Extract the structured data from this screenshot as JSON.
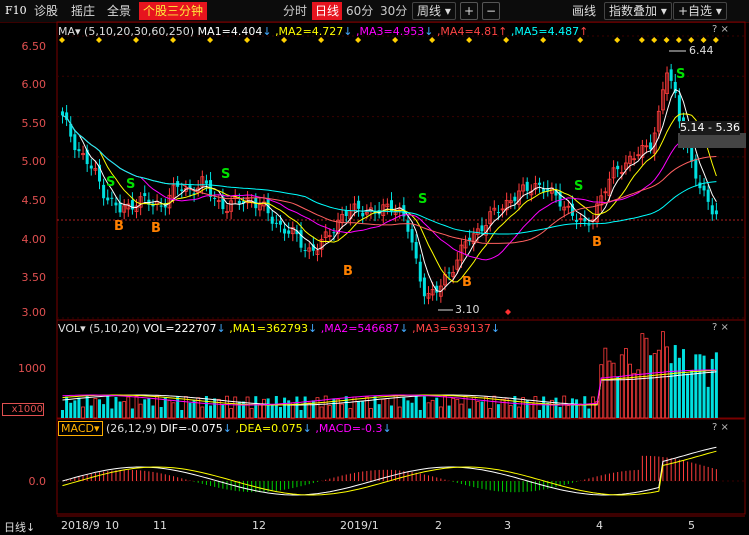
{
  "topbar": {
    "f10": "F10",
    "diagnose": "诊股",
    "pick": "摇庄",
    "panorama": "全景",
    "intraday3": "个股三分钟",
    "periods": [
      "分时",
      "日线",
      "60分",
      "30分"
    ],
    "selected_period": "日线",
    "more_periods": "周线",
    "plus": "+",
    "minus": "−",
    "draw": "画线",
    "overlay_index": "指数叠加",
    "add_watchlist": "+自选",
    "colors": {
      "accent": "#e6141e",
      "text": "#ffeb3b"
    }
  },
  "main_panel": {
    "label": "MA▾",
    "params": "(5,10,20,30,60,250)",
    "ma1": "MA1=4.404",
    "ma2": ",MA2=4.727",
    "ma3": ",MA3=4.953",
    "ma4": ",MA4=4.81",
    "ma5": ",MA5=4.487",
    "high_label": "6.44",
    "low_label": "3.10",
    "range_label": "5.14 - 5.36",
    "y_ticks": [
      "6.50",
      "6.00",
      "5.50",
      "5.00",
      "4.50",
      "4.00",
      "3.50",
      "3.00"
    ]
  },
  "vol_panel": {
    "label": "VOL▾",
    "params": "(5,10,20)",
    "vol": "VOL=222707",
    "ma1": ",MA1=362793",
    "ma2": ",MA2=546687",
    "ma3": ",MA3=639137",
    "y_tick": "1000",
    "unit": "x1000"
  },
  "macd_panel": {
    "label": "MACD▾",
    "params": "(26,12,9)",
    "dif": "DIF=-0.075",
    "dea": ",DEA=0.075",
    "macd": ",MACD=-0.3",
    "y_tick": "0.0"
  },
  "bottom": {
    "period_label": "日线",
    "dates": [
      "2018/9",
      "10",
      "11",
      "12",
      "2019/1",
      "2",
      "3",
      "4",
      "5"
    ]
  },
  "icons": {
    "settings": "?",
    "close": "×"
  },
  "chart_data": {
    "type": "candlestick",
    "title": "",
    "ylim": [
      3.0,
      6.5
    ],
    "x": [
      "2018/9",
      "10",
      "11",
      "12",
      "2019/1",
      "2",
      "3",
      "4",
      "5"
    ],
    "close_series": [
      5.4,
      5.2,
      5.0,
      4.85,
      4.7,
      4.5,
      4.35,
      4.25,
      4.3,
      4.4,
      4.38,
      4.3,
      4.35,
      4.45,
      4.55,
      4.5,
      4.55,
      4.6,
      4.45,
      4.35,
      4.3,
      4.35,
      4.4,
      4.38,
      4.3,
      4.2,
      4.1,
      4.0,
      3.95,
      3.85,
      3.75,
      3.8,
      3.95,
      4.1,
      4.2,
      4.25,
      4.3,
      4.25,
      4.2,
      4.3,
      4.35,
      4.2,
      3.95,
      3.5,
      3.2,
      3.2,
      3.4,
      3.55,
      3.7,
      3.9,
      4.0,
      4.1,
      4.2,
      4.3,
      4.4,
      4.45,
      4.5,
      4.6,
      4.55,
      4.45,
      4.4,
      4.3,
      4.15,
      4.05,
      4.2,
      4.4,
      4.6,
      4.8,
      4.85,
      4.9,
      5.0,
      5.1,
      5.4,
      6.0,
      5.7,
      5.2,
      4.8,
      4.55,
      4.4,
      4.2
    ],
    "annotations": [
      "6.44",
      "3.10",
      "5.14 - 5.36"
    ],
    "signals": {
      "S": [
        13,
        15,
        19,
        27,
        47,
        92,
        124,
        178
      ],
      "B": [
        15,
        18,
        26,
        45,
        75,
        105,
        124
      ]
    }
  }
}
